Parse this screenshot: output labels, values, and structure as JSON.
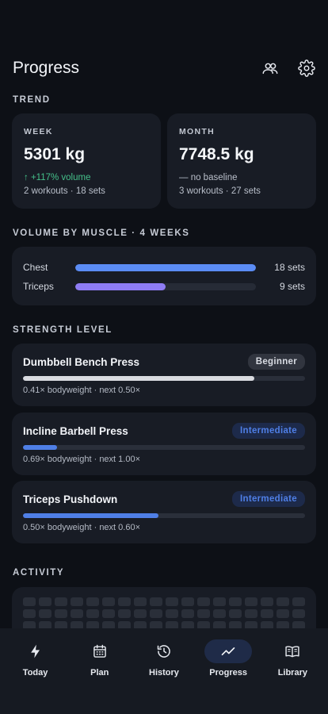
{
  "header": {
    "title": "Progress",
    "icons": [
      "people-icon",
      "gear-icon"
    ]
  },
  "trend": {
    "label": "TREND",
    "week": {
      "label": "WEEK",
      "value": "5301 kg",
      "change": "↑ +117% volume",
      "meta": "2 workouts · 18 sets"
    },
    "month": {
      "label": "MONTH",
      "value": "7748.5 kg",
      "change": "— no baseline",
      "meta": "3 workouts · 27 sets"
    }
  },
  "volume": {
    "label": "VOLUME BY MUSCLE · 4 WEEKS",
    "rows": [
      {
        "name": "Chest",
        "sets": "18 sets",
        "fraction": 1.0,
        "color": "#5b8cf5"
      },
      {
        "name": "Triceps",
        "sets": "9 sets",
        "fraction": 0.5,
        "color": "#8e7cf4"
      }
    ]
  },
  "strength": {
    "label": "STRENGTH LEVEL",
    "items": [
      {
        "name": "Dumbbell Bench Press",
        "badge": "Beginner",
        "level": "beginner",
        "meta": "0.41× bodyweight · next 0.50×",
        "fraction": 0.82,
        "color": "#d9dbe0"
      },
      {
        "name": "Incline Barbell Press",
        "badge": "Intermediate",
        "level": "intermediate",
        "meta": "0.69× bodyweight · next 1.00×",
        "fraction": 0.12,
        "color": "#4f7fe6"
      },
      {
        "name": "Triceps Pushdown",
        "badge": "Intermediate",
        "level": "intermediate",
        "meta": "0.50× bodyweight · next 0.60×",
        "fraction": 0.48,
        "color": "#4f7fe6"
      }
    ]
  },
  "activity": {
    "label": "ACTIVITY"
  },
  "tabs": [
    {
      "label": "Today",
      "icon": "bolt-icon",
      "active": false
    },
    {
      "label": "Plan",
      "icon": "calendar-icon",
      "active": false
    },
    {
      "label": "History",
      "icon": "history-icon",
      "active": false
    },
    {
      "label": "Progress",
      "icon": "trend-icon",
      "active": true
    },
    {
      "label": "Library",
      "icon": "book-icon",
      "active": false
    }
  ]
}
